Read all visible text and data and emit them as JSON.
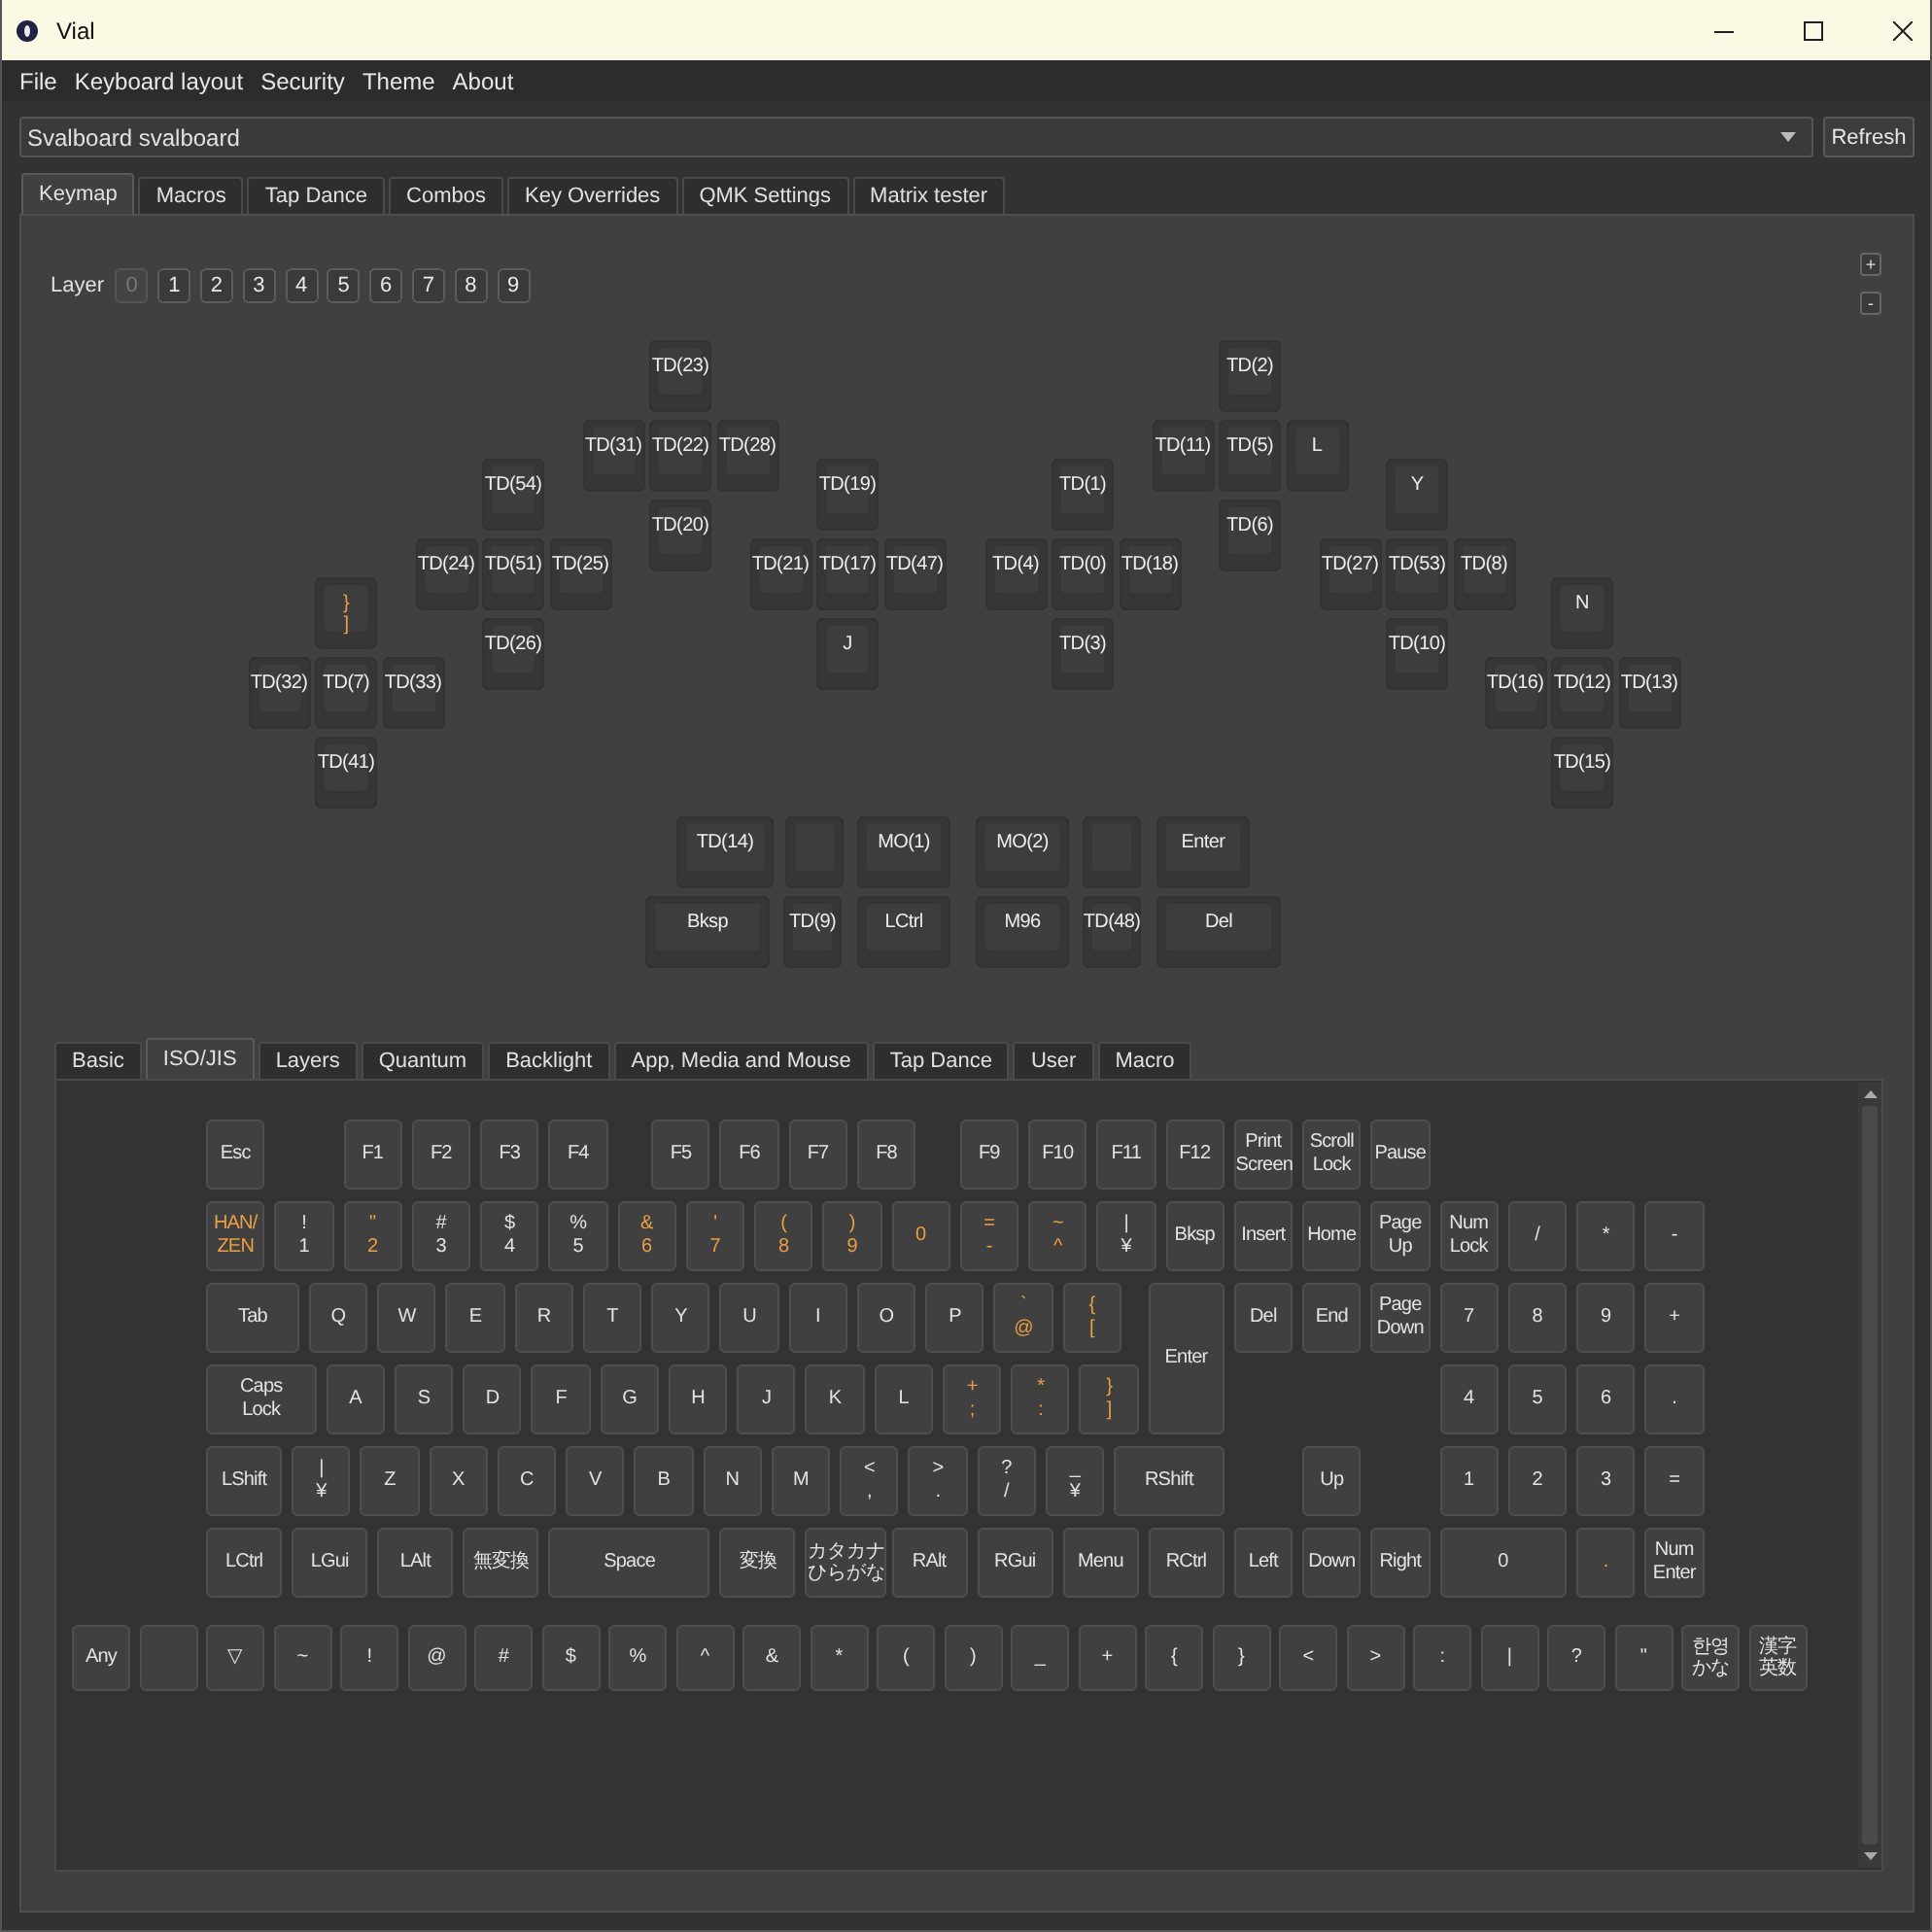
{
  "window": {
    "title": "Vial"
  },
  "menu": [
    "File",
    "Keyboard layout",
    "Security",
    "Theme",
    "About"
  ],
  "keyboard_select": {
    "value": "Svalboard svalboard"
  },
  "refresh_button": "Refresh",
  "tabs": [
    {
      "label": "Keymap",
      "selected": true
    },
    {
      "label": "Macros",
      "selected": false
    },
    {
      "label": "Tap Dance",
      "selected": false
    },
    {
      "label": "Combos",
      "selected": false
    },
    {
      "label": "Key Overrides",
      "selected": false
    },
    {
      "label": "QMK Settings",
      "selected": false
    },
    {
      "label": "Matrix tester",
      "selected": false
    }
  ],
  "layer_label": "Layer",
  "layers": [
    {
      "label": "0",
      "selected": true
    },
    {
      "label": "1",
      "selected": false
    },
    {
      "label": "2",
      "selected": false
    },
    {
      "label": "3",
      "selected": false
    },
    {
      "label": "4",
      "selected": false
    },
    {
      "label": "5",
      "selected": false
    },
    {
      "label": "6",
      "selected": false
    },
    {
      "label": "7",
      "selected": false
    },
    {
      "label": "8",
      "selected": false
    },
    {
      "label": "9",
      "selected": false
    }
  ],
  "layer_count_buttons": [
    "+",
    "-"
  ],
  "keymap": {
    "clusters": [
      {
        "keys": [
          {
            "label": "}\n]",
            "highlighted": true
          },
          {
            "label": "TD(32)",
            "highlighted": false
          },
          {
            "label": "TD(7)",
            "highlighted": false
          },
          {
            "label": "TD(33)",
            "highlighted": false
          },
          {
            "label": "TD(41)",
            "highlighted": false
          }
        ]
      },
      {
        "keys": [
          {
            "label": "TD(54)",
            "highlighted": false
          },
          {
            "label": "TD(24)",
            "highlighted": false
          },
          {
            "label": "TD(51)",
            "highlighted": false
          },
          {
            "label": "TD(25)",
            "highlighted": false
          },
          {
            "label": "TD(26)",
            "highlighted": false
          }
        ]
      },
      {
        "keys": [
          {
            "label": "TD(23)",
            "highlighted": false
          },
          {
            "label": "TD(31)",
            "highlighted": false
          },
          {
            "label": "TD(22)",
            "highlighted": false
          },
          {
            "label": "TD(28)",
            "highlighted": false
          },
          {
            "label": "TD(20)",
            "highlighted": false
          }
        ]
      },
      {
        "keys": [
          {
            "label": "TD(19)",
            "highlighted": false
          },
          {
            "label": "TD(21)",
            "highlighted": false
          },
          {
            "label": "TD(17)",
            "highlighted": false
          },
          {
            "label": "TD(47)",
            "highlighted": false
          },
          {
            "label": "J",
            "highlighted": false
          }
        ]
      },
      {
        "keys": [
          {
            "label": "TD(1)",
            "highlighted": false
          },
          {
            "label": "TD(4)",
            "highlighted": false
          },
          {
            "label": "TD(0)",
            "highlighted": false
          },
          {
            "label": "TD(18)",
            "highlighted": false
          },
          {
            "label": "TD(3)",
            "highlighted": false
          }
        ]
      },
      {
        "keys": [
          {
            "label": "TD(2)",
            "highlighted": false
          },
          {
            "label": "TD(11)",
            "highlighted": false
          },
          {
            "label": "TD(5)",
            "highlighted": false
          },
          {
            "label": "L",
            "highlighted": false
          },
          {
            "label": "TD(6)",
            "highlighted": false
          }
        ]
      },
      {
        "keys": [
          {
            "label": "Y",
            "highlighted": false
          },
          {
            "label": "TD(27)",
            "highlighted": false
          },
          {
            "label": "TD(53)",
            "highlighted": false
          },
          {
            "label": "TD(8)",
            "highlighted": false
          },
          {
            "label": "TD(10)",
            "highlighted": false
          }
        ]
      },
      {
        "keys": [
          {
            "label": "N",
            "highlighted": false
          },
          {
            "label": "TD(16)",
            "highlighted": false
          },
          {
            "label": "TD(12)",
            "highlighted": false
          },
          {
            "label": "TD(13)",
            "highlighted": false
          },
          {
            "label": "TD(15)",
            "highlighted": false
          }
        ]
      }
    ],
    "thumb_rows": [
      [
        {
          "kind": "key",
          "label": "TD(14)",
          "highlighted": false
        },
        {
          "kind": "blank"
        },
        {
          "kind": "key",
          "label": "MO(1)",
          "highlighted": false
        },
        {
          "kind": "key",
          "label": "MO(2)",
          "highlighted": false
        },
        {
          "kind": "blank"
        },
        {
          "kind": "key",
          "label": "Enter",
          "highlighted": false
        }
      ],
      [
        {
          "kind": "key",
          "label": "Bksp",
          "highlighted": false
        },
        {
          "kind": "key",
          "label": "TD(9)",
          "highlighted": false
        },
        {
          "kind": "key",
          "label": "LCtrl",
          "highlighted": false
        },
        {
          "kind": "key",
          "label": "M96",
          "highlighted": false
        },
        {
          "kind": "key",
          "label": "TD(48)",
          "highlighted": false
        },
        {
          "kind": "key",
          "label": "Del",
          "highlighted": false
        }
      ]
    ]
  },
  "keycode_tabs": [
    {
      "label": "Basic",
      "selected": false
    },
    {
      "label": "ISO/JIS",
      "selected": true
    },
    {
      "label": "Layers",
      "selected": false
    },
    {
      "label": "Quantum",
      "selected": false
    },
    {
      "label": "Backlight",
      "selected": false
    },
    {
      "label": "App, Media and Mouse",
      "selected": false
    },
    {
      "label": "Tap Dance",
      "selected": false
    },
    {
      "label": "User",
      "selected": false
    },
    {
      "label": "Macro",
      "selected": false
    }
  ],
  "iso_jis": {
    "rows": [
      {
        "keys": [
          {
            "label": "Esc",
            "highlighted": false
          },
          {
            "label": "F1",
            "highlighted": false
          },
          {
            "label": "F2",
            "highlighted": false
          },
          {
            "label": "F3",
            "highlighted": false
          },
          {
            "label": "F4",
            "highlighted": false
          },
          {
            "label": "F5",
            "highlighted": false
          },
          {
            "label": "F6",
            "highlighted": false
          },
          {
            "label": "F7",
            "highlighted": false
          },
          {
            "label": "F8",
            "highlighted": false
          },
          {
            "label": "F9",
            "highlighted": false
          },
          {
            "label": "F10",
            "highlighted": false
          },
          {
            "label": "F11",
            "highlighted": false
          },
          {
            "label": "F12",
            "highlighted": false
          },
          {
            "label": "Print\nScreen",
            "highlighted": false
          },
          {
            "label": "Scroll\nLock",
            "highlighted": false
          },
          {
            "label": "Pause",
            "highlighted": false
          }
        ]
      },
      {
        "keys": [
          {
            "label": "HAN/\nZEN",
            "highlighted": true
          },
          {
            "label": "!\n1",
            "highlighted": false
          },
          {
            "label": "\"\n2",
            "highlighted": true
          },
          {
            "label": "#\n3",
            "highlighted": false
          },
          {
            "label": "$\n4",
            "highlighted": false
          },
          {
            "label": "%\n5",
            "highlighted": false
          },
          {
            "label": "&\n6",
            "highlighted": true
          },
          {
            "label": "'\n7",
            "highlighted": true
          },
          {
            "label": "(\n8",
            "highlighted": true
          },
          {
            "label": ")\n9",
            "highlighted": true
          },
          {
            "label": "0",
            "highlighted": true
          },
          {
            "label": "=\n-",
            "highlighted": true
          },
          {
            "label": "~\n^",
            "highlighted": true
          },
          {
            "label": "|\n¥",
            "highlighted": false
          },
          {
            "label": "Bksp",
            "highlighted": false
          },
          {
            "label": "Insert",
            "highlighted": false
          },
          {
            "label": "Home",
            "highlighted": false
          },
          {
            "label": "Page\nUp",
            "highlighted": false
          },
          {
            "label": "Num\nLock",
            "highlighted": false
          },
          {
            "label": "/",
            "highlighted": false
          },
          {
            "label": "*",
            "highlighted": false
          },
          {
            "label": "-",
            "highlighted": false
          }
        ]
      },
      {
        "keys": [
          {
            "label": "Tab",
            "highlighted": false
          },
          {
            "label": "Q",
            "highlighted": false
          },
          {
            "label": "W",
            "highlighted": false
          },
          {
            "label": "E",
            "highlighted": false
          },
          {
            "label": "R",
            "highlighted": false
          },
          {
            "label": "T",
            "highlighted": false
          },
          {
            "label": "Y",
            "highlighted": false
          },
          {
            "label": "U",
            "highlighted": false
          },
          {
            "label": "I",
            "highlighted": false
          },
          {
            "label": "O",
            "highlighted": false
          },
          {
            "label": "P",
            "highlighted": false
          },
          {
            "label": "`\n@",
            "highlighted": true
          },
          {
            "label": "{\n[",
            "highlighted": true
          },
          {
            "label": "Enter",
            "highlighted": false
          },
          {
            "label": "Del",
            "highlighted": false
          },
          {
            "label": "End",
            "highlighted": false
          },
          {
            "label": "Page\nDown",
            "highlighted": false
          },
          {
            "label": "7",
            "highlighted": false
          },
          {
            "label": "8",
            "highlighted": false
          },
          {
            "label": "9",
            "highlighted": false
          },
          {
            "label": "+",
            "highlighted": false
          }
        ]
      },
      {
        "keys": [
          {
            "label": "Caps\nLock",
            "highlighted": false
          },
          {
            "label": "A",
            "highlighted": false
          },
          {
            "label": "S",
            "highlighted": false
          },
          {
            "label": "D",
            "highlighted": false
          },
          {
            "label": "F",
            "highlighted": false
          },
          {
            "label": "G",
            "highlighted": false
          },
          {
            "label": "H",
            "highlighted": false
          },
          {
            "label": "J",
            "highlighted": false
          },
          {
            "label": "K",
            "highlighted": false
          },
          {
            "label": "L",
            "highlighted": false
          },
          {
            "label": "+\n;",
            "highlighted": true
          },
          {
            "label": "*\n:",
            "highlighted": true
          },
          {
            "label": "}\n]",
            "highlighted": true
          },
          {
            "label": "4",
            "highlighted": false
          },
          {
            "label": "5",
            "highlighted": false
          },
          {
            "label": "6",
            "highlighted": false
          },
          {
            "label": ".",
            "highlighted": false
          }
        ]
      },
      {
        "keys": [
          {
            "label": "LShift",
            "highlighted": false
          },
          {
            "label": "|\n¥",
            "highlighted": false
          },
          {
            "label": "Z",
            "highlighted": false
          },
          {
            "label": "X",
            "highlighted": false
          },
          {
            "label": "C",
            "highlighted": false
          },
          {
            "label": "V",
            "highlighted": false
          },
          {
            "label": "B",
            "highlighted": false
          },
          {
            "label": "N",
            "highlighted": false
          },
          {
            "label": "M",
            "highlighted": false
          },
          {
            "label": "<\n,",
            "highlighted": false
          },
          {
            "label": ">\n.",
            "highlighted": false
          },
          {
            "label": "?\n/",
            "highlighted": false
          },
          {
            "label": "_\n¥",
            "highlighted": false
          },
          {
            "label": "RShift",
            "highlighted": false
          },
          {
            "label": "Up",
            "highlighted": false
          },
          {
            "label": "1",
            "highlighted": false
          },
          {
            "label": "2",
            "highlighted": false
          },
          {
            "label": "3",
            "highlighted": false
          },
          {
            "label": "=",
            "highlighted": false
          }
        ]
      },
      {
        "keys": [
          {
            "label": "LCtrl",
            "highlighted": false
          },
          {
            "label": "LGui",
            "highlighted": false
          },
          {
            "label": "LAlt",
            "highlighted": false
          },
          {
            "label": "無変換",
            "highlighted": false
          },
          {
            "label": "Space",
            "highlighted": false
          },
          {
            "label": "変換",
            "highlighted": false
          },
          {
            "label": "カタカナひらがな",
            "highlighted": false
          },
          {
            "label": "RAlt",
            "highlighted": false
          },
          {
            "label": "RGui",
            "highlighted": false
          },
          {
            "label": "Menu",
            "highlighted": false
          },
          {
            "label": "RCtrl",
            "highlighted": false
          },
          {
            "label": "Left",
            "highlighted": false
          },
          {
            "label": "Down",
            "highlighted": false
          },
          {
            "label": "Right",
            "highlighted": false
          },
          {
            "label": "0",
            "highlighted": false
          },
          {
            "label": ".",
            "highlighted": true
          },
          {
            "label": "Num\nEnter",
            "highlighted": false
          }
        ]
      }
    ],
    "extra_row": [
      {
        "kind": "key",
        "label": "Any",
        "highlighted": false
      },
      {
        "kind": "blank"
      },
      {
        "kind": "key",
        "label": "▽",
        "highlighted": false
      },
      {
        "kind": "key",
        "label": "~",
        "highlighted": false
      },
      {
        "kind": "key",
        "label": "!",
        "highlighted": false
      },
      {
        "kind": "key",
        "label": "@",
        "highlighted": false
      },
      {
        "kind": "key",
        "label": "#",
        "highlighted": false
      },
      {
        "kind": "key",
        "label": "$",
        "highlighted": false
      },
      {
        "kind": "key",
        "label": "%",
        "highlighted": false
      },
      {
        "kind": "key",
        "label": "^",
        "highlighted": false
      },
      {
        "kind": "key",
        "label": "&",
        "highlighted": false
      },
      {
        "kind": "key",
        "label": "*",
        "highlighted": false
      },
      {
        "kind": "key",
        "label": "(",
        "highlighted": false
      },
      {
        "kind": "key",
        "label": ")",
        "highlighted": false
      },
      {
        "kind": "key",
        "label": "_",
        "highlighted": false
      },
      {
        "kind": "key",
        "label": "+",
        "highlighted": false
      },
      {
        "kind": "key",
        "label": "{",
        "highlighted": false
      },
      {
        "kind": "key",
        "label": "}",
        "highlighted": false
      },
      {
        "kind": "key",
        "label": "<",
        "highlighted": false
      },
      {
        "kind": "key",
        "label": ">",
        "highlighted": false
      },
      {
        "kind": "key",
        "label": ":",
        "highlighted": false
      },
      {
        "kind": "key",
        "label": "|",
        "highlighted": false
      },
      {
        "kind": "key",
        "label": "?",
        "highlighted": false
      },
      {
        "kind": "key",
        "label": "\"",
        "highlighted": false
      },
      {
        "kind": "key",
        "label": "한영かな",
        "highlighted": false
      },
      {
        "kind": "key",
        "label": "漢字英数",
        "highlighted": false
      }
    ]
  }
}
